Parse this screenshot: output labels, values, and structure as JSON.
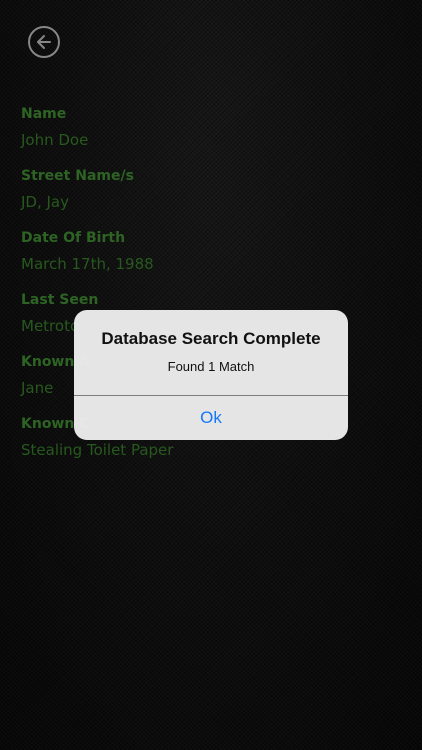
{
  "header": {
    "back_icon": "arrow-left-circle-icon"
  },
  "profile": {
    "fields": [
      {
        "label": "Name",
        "value": "John Doe"
      },
      {
        "label": "Street Name/s",
        "value": "JD, Jay"
      },
      {
        "label": "Date Of Birth",
        "value": "March 17th, 1988"
      },
      {
        "label": "Last Seen",
        "value": "Metroto"
      },
      {
        "label": "Known A",
        "value": "Jane"
      },
      {
        "label": "Known C",
        "value": "Stealing Toilet Paper"
      }
    ]
  },
  "alert": {
    "title": "Database Search Complete",
    "message": "Found 1 Match",
    "ok_label": "Ok"
  },
  "colors": {
    "label_green": "#4aa23a",
    "value_green": "#3f8f31",
    "ios_blue": "#1479f5",
    "background": "#141414"
  }
}
